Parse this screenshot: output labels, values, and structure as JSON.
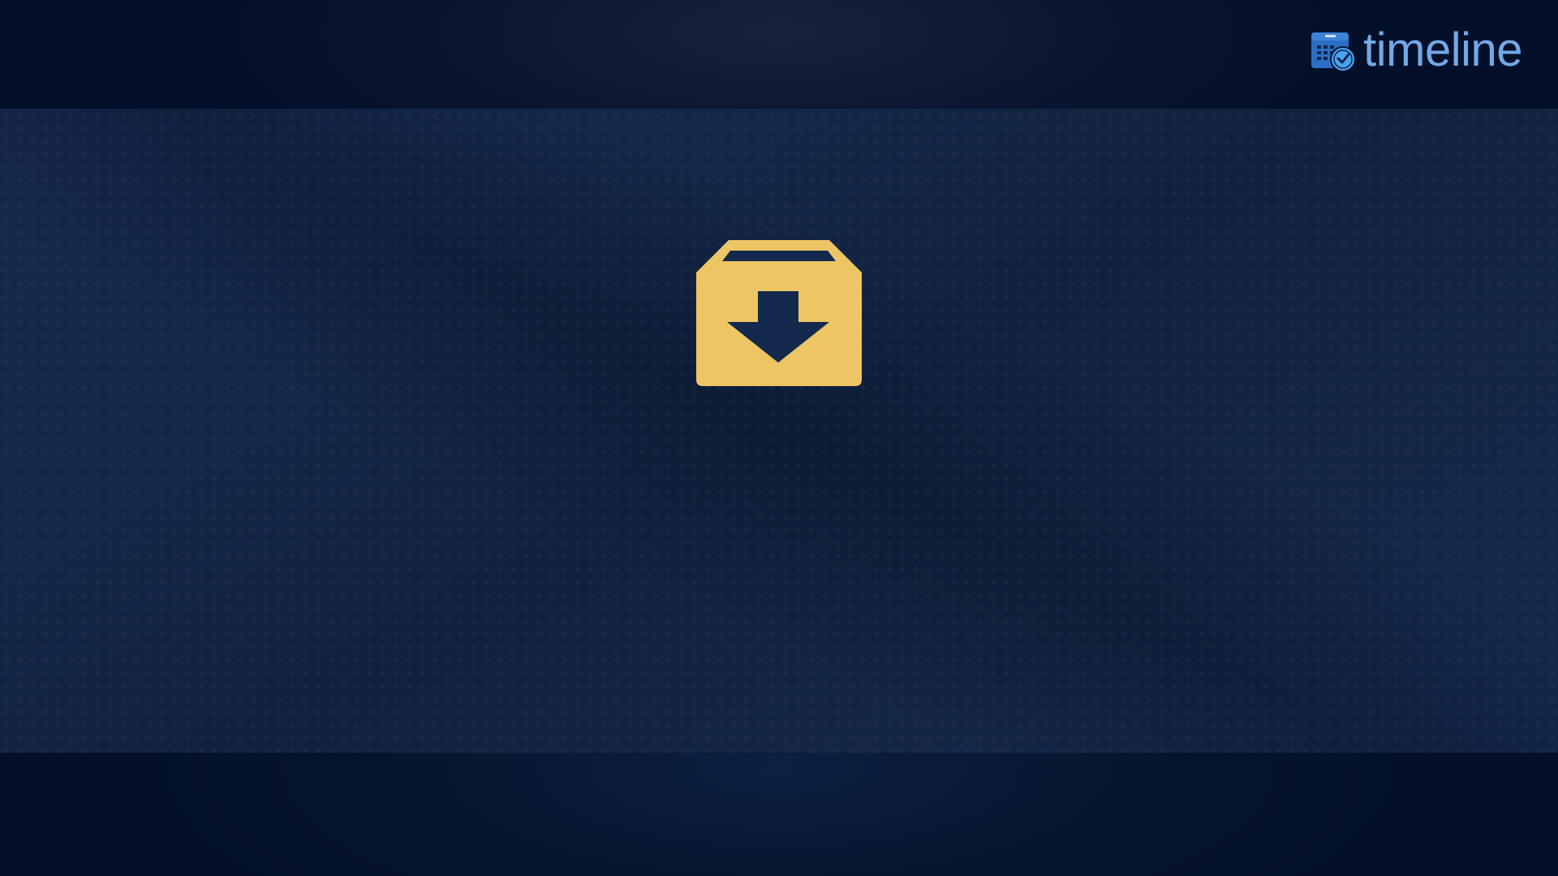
{
  "header": {
    "brand": {
      "icon": "calendar-clock-icon",
      "name": "timeline",
      "color": "#73a8e6"
    }
  },
  "main": {
    "center_icon": "archive-download-icon",
    "icon_color": "#edc565"
  }
}
